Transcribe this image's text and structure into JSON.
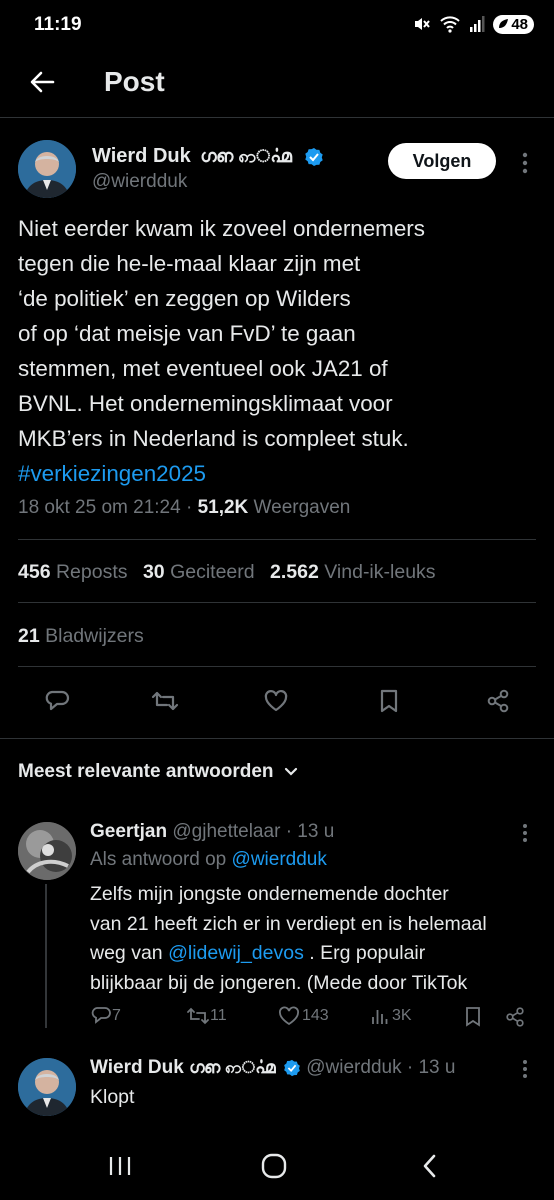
{
  "status_bar": {
    "time": "11:19",
    "battery": "48"
  },
  "header": {
    "title": "Post"
  },
  "post": {
    "author_name": "Wierd Duk",
    "author_glyphs": "ഗഩ ꩱൎ൶",
    "handle": "@wierdduk",
    "follow_label": "Volgen",
    "text_lines": [
      "Niet eerder kwam ik zoveel ondernemers",
      "tegen die he-le-maal klaar zijn met",
      "‘de politiek’ en zeggen op Wilders",
      "of op ‘dat meisje van FvD’ te gaan",
      "stemmen, met eventueel ook JA21 of",
      "BVNL. Het ondernemingsklimaat voor",
      "MKB’ers in Nederland is compleet stuk."
    ],
    "hashtag": "#verkiezingen2025",
    "timestamp": "18 okt 25 om 21:24",
    "separator": "·",
    "views_count": "51,2K",
    "views_label": "Weergaven",
    "reposts_count": "456",
    "reposts_label": "Reposts",
    "quotes_count": "30",
    "quotes_label": "Geciteerd",
    "likes_count": "2.562",
    "likes_label": "Vind-ik-leuks",
    "bookmarks_count": "21",
    "bookmarks_label": "Bladwijzers"
  },
  "replies_sort": {
    "label": "Meest relevante antwoorden"
  },
  "replies": [
    {
      "name": "Geertjan",
      "handle": "@gjhettelaar",
      "time": "· 13 u",
      "reply_to_prefix": "Als antwoord op",
      "reply_to_handle": "@wierdduk",
      "line1": "Zelfs mijn jongste ondernemende dochter",
      "line2a": "van 21 heeft zich er in verdiept en is helemaal",
      "line3a": "weg van",
      "mention": "@lidewij_devos",
      "line3b": ". Erg populair",
      "line4": "blijkbaar bij de jongeren. (Mede door TikTok",
      "comments": "7",
      "reposts": "11",
      "likes": "143",
      "views": "3K"
    },
    {
      "name": "Wierd Duk",
      "glyphs": "ഗഩ ꩱൎ൶",
      "handle": "@wierdduk",
      "time": "· 13 u",
      "text": "Klopt"
    }
  ],
  "colors": {
    "accent": "#1d9bf0",
    "background": "#000000",
    "muted": "#71767b",
    "divider": "#2f3336"
  }
}
